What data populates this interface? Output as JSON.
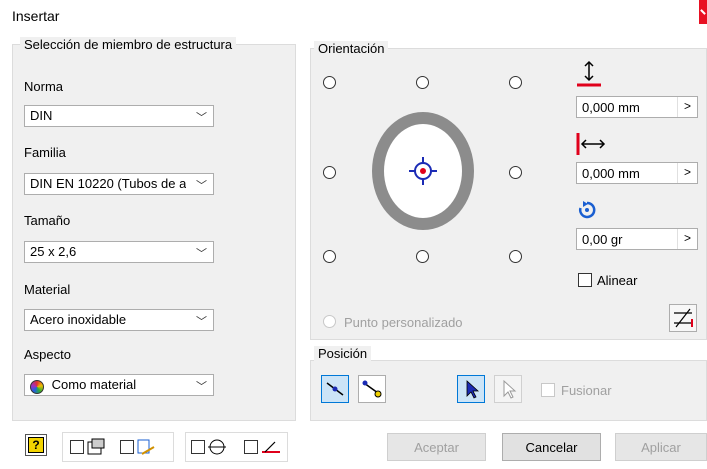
{
  "window": {
    "title": "Insertar"
  },
  "selection": {
    "group_title": "Selección de miembro de estructura",
    "norma": {
      "label": "Norma",
      "value": "DIN"
    },
    "familia": {
      "label": "Familia",
      "value": "DIN EN 10220 (Tubos de a"
    },
    "tamano": {
      "label": "Tamaño",
      "value": "25 x 2,6"
    },
    "material": {
      "label": "Material",
      "value": "Acero inoxidable"
    },
    "aspecto": {
      "label": "Aspecto",
      "value": "Como material"
    }
  },
  "orientation": {
    "group_title": "Orientación",
    "custom_point_label": "Punto personalizado",
    "offset_y": "0,000 mm",
    "offset_x": "0,000 mm",
    "rotation": "0,00 gr",
    "align_label": "Alinear",
    "spin_arrow": ">"
  },
  "position": {
    "group_title": "Posición",
    "merge_label": "Fusionar"
  },
  "buttons": {
    "accept": "Aceptar",
    "cancel": "Cancelar",
    "apply": "Aplicar"
  },
  "icons": {
    "help": "?",
    "chevron": "﹀"
  },
  "colors": {
    "accent": "#0078d7",
    "target_red": "#e0001b",
    "ring_gray": "#8c8c8c"
  }
}
